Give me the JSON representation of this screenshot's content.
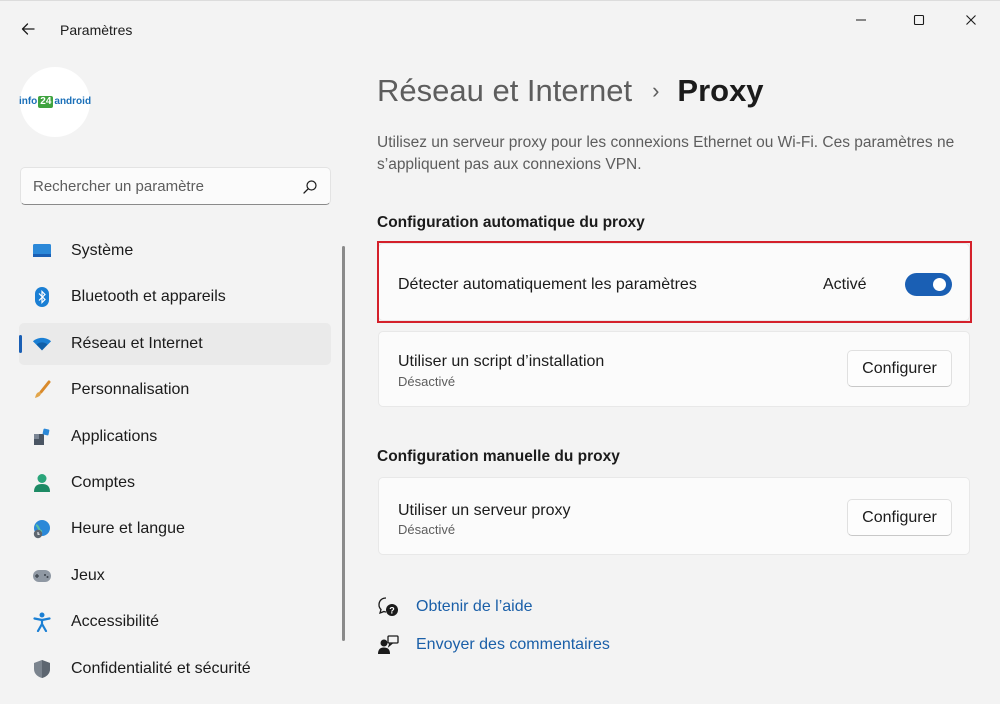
{
  "window": {
    "title": "Paramètres",
    "controls": [
      "minimize-icon",
      "maximize-icon",
      "close-icon"
    ]
  },
  "user": {
    "logo_parts": [
      "info",
      "24",
      "android"
    ]
  },
  "search": {
    "placeholder": "Rechercher un paramètre"
  },
  "sidebar": {
    "items": [
      {
        "label": "Système",
        "icon": "system-icon",
        "active": false
      },
      {
        "label": "Bluetooth et appareils",
        "icon": "bluetooth-icon",
        "active": false
      },
      {
        "label": "Réseau et Internet",
        "icon": "wifi-icon",
        "active": true
      },
      {
        "label": "Personnalisation",
        "icon": "brush-icon",
        "active": false
      },
      {
        "label": "Applications",
        "icon": "apps-icon",
        "active": false
      },
      {
        "label": "Comptes",
        "icon": "account-icon",
        "active": false
      },
      {
        "label": "Heure et langue",
        "icon": "globe-clock-icon",
        "active": false
      },
      {
        "label": "Jeux",
        "icon": "gamepad-icon",
        "active": false
      },
      {
        "label": "Accessibilité",
        "icon": "accessibility-icon",
        "active": false
      },
      {
        "label": "Confidentialité et sécurité",
        "icon": "shield-icon",
        "active": false
      }
    ]
  },
  "main": {
    "breadcrumb": {
      "parent": "Réseau et Internet",
      "separator": "›",
      "current": "Proxy"
    },
    "description": "Utilisez un serveur proxy pour les connexions Ethernet ou Wi-Fi. Ces paramètres ne s’appliquent pas aux connexions VPN.",
    "auto_section": {
      "title": "Configuration automatique du proxy",
      "detect": {
        "label": "Détecter automatiquement les paramètres",
        "state_label": "Activé",
        "on": true
      },
      "script": {
        "label": "Utiliser un script d’installation",
        "status": "Désactivé",
        "button": "Configurer"
      }
    },
    "manual_section": {
      "title": "Configuration manuelle du proxy",
      "proxy": {
        "label": "Utiliser un serveur proxy",
        "status": "Désactivé",
        "button": "Configurer"
      }
    },
    "links": {
      "help": "Obtenir de l’aide",
      "feedback": "Envoyer des commentaires"
    }
  },
  "colors": {
    "accent": "#1a5fb4",
    "highlight": "#d4202a",
    "background": "#f3f3f3",
    "card": "#fbfbfb"
  }
}
